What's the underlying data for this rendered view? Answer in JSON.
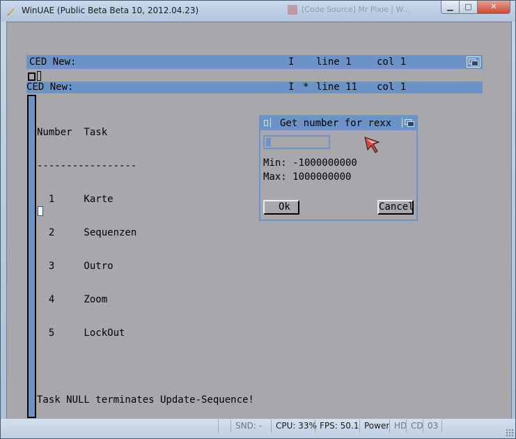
{
  "window": {
    "title": "WinUAE (Public Beta Beta 10, 2012.04.23)",
    "background_title": "[Code Source] Mr Pixie | W...",
    "minimize_glyph": "▁",
    "maximize_glyph": "□",
    "close_glyph": "✕",
    "icon": "winuae-app-icon"
  },
  "editor": {
    "bar1": {
      "name": "CED New:",
      "status": "I",
      "line": "line 1",
      "col": "col 1"
    },
    "bar2": {
      "name": "CED New:",
      "status": "I",
      "modified": "*",
      "line": "line 11",
      "col": "col 1"
    },
    "lines": [
      "Number  Task",
      "-----------------",
      "  1     Karte",
      "  2     Sequenzen",
      "  3     Outro",
      "  4     Zoom",
      "  5     LockOut",
      "",
      "Task NULL terminates Update-Sequence!"
    ]
  },
  "dialog": {
    "title": "Get number for rexx",
    "input_value": "",
    "min_label": "Min: -1000000000",
    "max_label": "Max: 1000000000",
    "ok_label": "Ok",
    "cancel_label": "Cancel"
  },
  "statusbar": {
    "snd": "SND: -",
    "cpu": "CPU: 33%",
    "fps": "FPS: 50.1",
    "power": "Power",
    "hd": "HD",
    "cd": "CD",
    "df": "03"
  },
  "colors": {
    "amiga_blue": "#6c93c7",
    "amiga_grey": "#a8a8ac",
    "close_red": "#c54a32"
  }
}
